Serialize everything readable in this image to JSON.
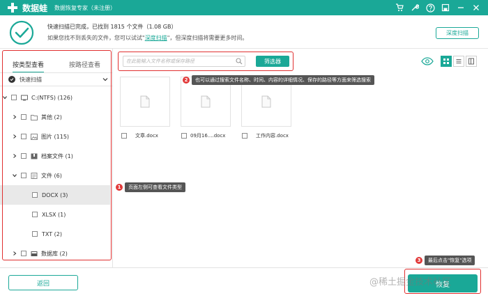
{
  "colors": {
    "accent": "#1aa897",
    "annotation_red": "#e02f2f",
    "tooltip_bg": "#555555"
  },
  "titlebar": {
    "app_name": "数据蛙",
    "subtitle": "数据恢复专家（未注册）",
    "icons": [
      "cart-icon",
      "wrench-icon",
      "help-icon",
      "save-icon",
      "minimize-icon",
      "close-icon"
    ]
  },
  "scan": {
    "status": "快速扫描已完成，已找到 1815 个文件（1.08 GB）",
    "hint_before": "如果您找不到丢失的文件，您可以试试\"",
    "hint_link": "深度扫描",
    "hint_after": "\"，但深度扫描将需要更多时间。",
    "deep_scan_button": "深度扫描"
  },
  "left": {
    "tabs": [
      "按类型查看",
      "按路径查看"
    ],
    "quick_scan": "快速扫描",
    "tree": [
      {
        "label": "C:(NTFS) (126)",
        "icon": "disk-icon",
        "arrow": "down",
        "level": 0
      },
      {
        "label": "其他 (2)",
        "icon": "folder-icon",
        "arrow": "right",
        "level": 1
      },
      {
        "label": "图片 (115)",
        "icon": "image-icon",
        "arrow": "right",
        "level": 1
      },
      {
        "label": "档案文件 (1)",
        "icon": "archive-icon",
        "arrow": "right",
        "level": 1
      },
      {
        "label": "文件 (6)",
        "icon": "document-icon",
        "arrow": "down",
        "level": 1
      },
      {
        "label": "DOCX (3)",
        "icon": "",
        "arrow": "",
        "level": 2,
        "selected": true
      },
      {
        "label": "XLSX (1)",
        "icon": "",
        "arrow": "",
        "level": 2
      },
      {
        "label": "TXT (2)",
        "icon": "",
        "arrow": "",
        "level": 2
      },
      {
        "label": "数据库 (2)",
        "icon": "database-icon",
        "arrow": "right",
        "level": 1
      }
    ]
  },
  "toolbar": {
    "search_placeholder": "在此能输入文件名称或保存路径",
    "filter_button": "筛选器"
  },
  "files": [
    {
      "name": "文章.docx"
    },
    {
      "name": "09月16....docx"
    },
    {
      "name": "工作内容.docx"
    }
  ],
  "annotations": {
    "a1": {
      "num": "1",
      "text": "页面左侧可查看文件类型"
    },
    "a2": {
      "num": "2",
      "text": "也可以通过搜索文件名称、时间、内容的详细情况、保存的路径等方面来筛选搜索"
    },
    "a3": {
      "num": "3",
      "text": "最后点击\"恢复\"选项"
    }
  },
  "footer": {
    "back_button": "返回",
    "recover_button": "恢复"
  },
  "watermark": "@稀土掘金技术社区"
}
